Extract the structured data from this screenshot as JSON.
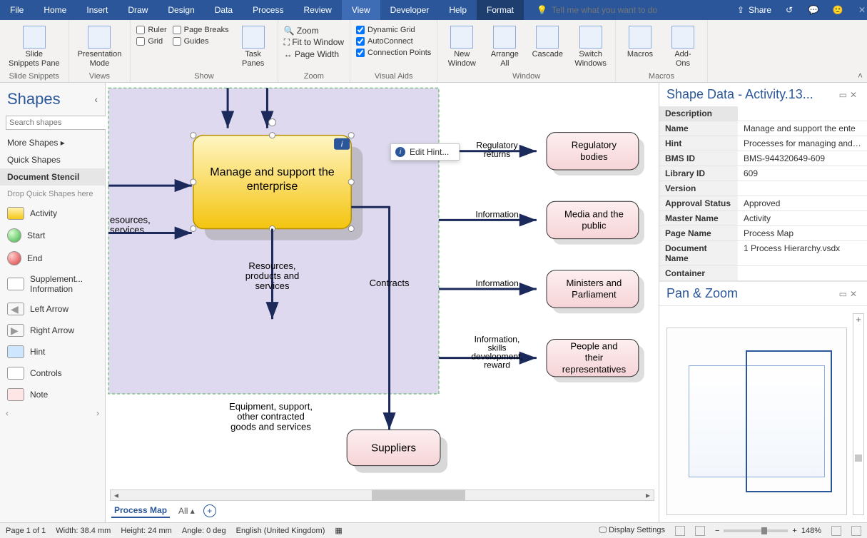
{
  "tabs": [
    "File",
    "Home",
    "Insert",
    "Draw",
    "Design",
    "Data",
    "Process",
    "Review",
    "View",
    "Developer",
    "Help",
    "Format"
  ],
  "activeTab": "View",
  "tellme_placeholder": "Tell me what you want to do",
  "share_label": "Share",
  "ribbon": {
    "slide_snippets": {
      "btn": "Slide\nSnippets Pane",
      "group": "Slide Snippets"
    },
    "views": {
      "btn": "Presentation\nMode",
      "group": "Views"
    },
    "show": {
      "ruler": "Ruler",
      "pagebreaks": "Page Breaks",
      "grid": "Grid",
      "guides": "Guides",
      "taskpanes": "Task\nPanes",
      "group": "Show"
    },
    "zoom": {
      "zoom": "Zoom",
      "fit": "Fit to Window",
      "width": "Page Width",
      "group": "Zoom"
    },
    "visual": {
      "dgrid": "Dynamic Grid",
      "auto": "AutoConnect",
      "cp": "Connection Points",
      "group": "Visual Aids"
    },
    "window": {
      "new": "New\nWindow",
      "arr": "Arrange\nAll",
      "casc": "Cascade",
      "switch": "Switch\nWindows",
      "group": "Window"
    },
    "macros": {
      "mac": "Macros",
      "addons": "Add-\nOns",
      "group": "Macros"
    }
  },
  "shapes": {
    "title": "Shapes",
    "search_placeholder": "Search shapes",
    "more": "More Shapes",
    "quick": "Quick Shapes",
    "doc": "Document Stencil",
    "drop": "Drop Quick Shapes here",
    "items": [
      {
        "label": "Activity",
        "cls": "activity"
      },
      {
        "label": "Start",
        "cls": "start"
      },
      {
        "label": "End",
        "cls": "end"
      },
      {
        "label": "Supplement... Information",
        "cls": "supp"
      },
      {
        "label": "Left Arrow",
        "cls": "la"
      },
      {
        "label": "Right Arrow",
        "cls": "ra"
      },
      {
        "label": "Hint",
        "cls": "hint"
      },
      {
        "label": "Controls",
        "cls": "ctrl"
      },
      {
        "label": "Note",
        "cls": "note"
      }
    ]
  },
  "diagram": {
    "main_shape": "Manage and support the enterprise",
    "left_in": "esources,\nservices",
    "down_out": "Resources,\nproducts and\nservices",
    "contracts": "Contracts",
    "suppliers_in": "Equipment, support,\nother contracted\ngoods and services",
    "suppliers": "Suppliers",
    "r1_lbl": "Regulatory\nreturns",
    "r1": "Regulatory\nbodies",
    "r2_lbl": "Information",
    "r2": "Media and the\npublic",
    "r3_lbl": "Information",
    "r3": "Ministers and\nParliament",
    "r4_lbl": "Information,\nskills\ndevelopment,\nreward",
    "r4": "People and\ntheir\nrepresentatives",
    "edit_hint": "Edit Hint..."
  },
  "shapedata": {
    "title": "Shape Data - Activity.13...",
    "hdr": "Description",
    "rows": [
      {
        "k": "Name",
        "v": "Manage and support the ente"
      },
      {
        "k": "Hint",
        "v": "Processes for managing and su"
      },
      {
        "k": "BMS ID",
        "v": "BMS-944320649-609"
      },
      {
        "k": "Library ID",
        "v": "609"
      },
      {
        "k": "Version",
        "v": ""
      },
      {
        "k": "Approval Status",
        "v": "Approved"
      },
      {
        "k": "Master Name",
        "v": "Activity"
      },
      {
        "k": "Page Name",
        "v": "Process Map"
      },
      {
        "k": "Document Name",
        "v": "1       Process Hierarchy.vsdx"
      },
      {
        "k": "Container",
        "v": ""
      }
    ]
  },
  "panzoom_title": "Pan & Zoom",
  "sheet": {
    "tab": "Process Map",
    "all": "All"
  },
  "status": {
    "page": "Page 1 of 1",
    "width": "Width: 38.4 mm",
    "height": "Height: 24 mm",
    "angle": "Angle: 0 deg",
    "lang": "English (United Kingdom)",
    "display": "Display Settings",
    "zoom": "148%"
  }
}
